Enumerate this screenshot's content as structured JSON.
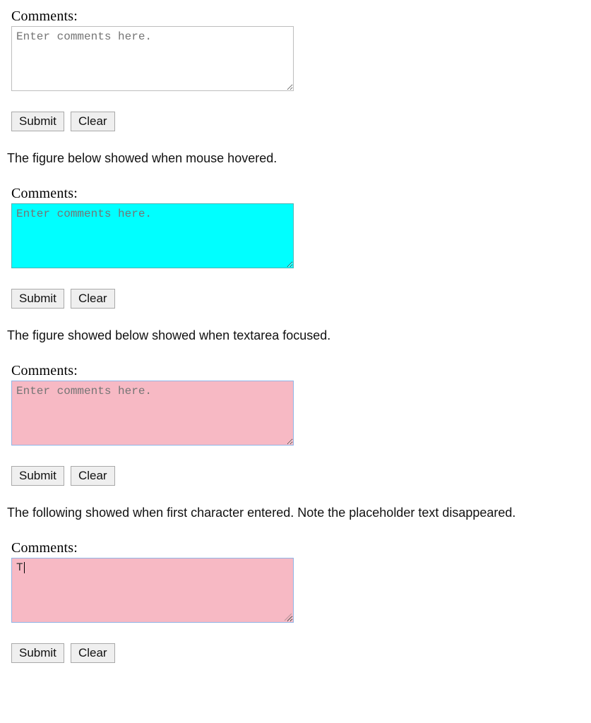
{
  "labels": {
    "comments": "Comments:"
  },
  "placeholders": {
    "comments": "Enter comments here."
  },
  "buttons": {
    "submit": "Submit",
    "clear": "Clear"
  },
  "captions": {
    "hover": "The figure below showed when mouse hovered.",
    "focus": "The figure showed below showed when textarea focused.",
    "typed": "The following showed when first character entered. Note the placeholder text disappeared."
  },
  "typed": {
    "value": "T"
  }
}
